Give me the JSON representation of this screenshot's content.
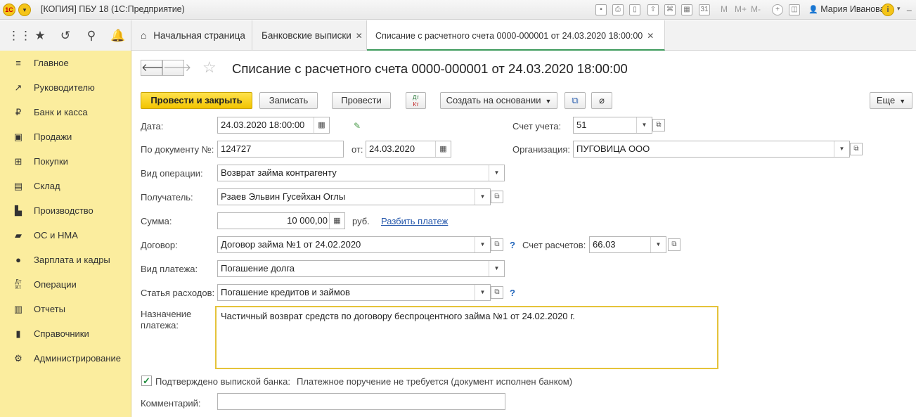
{
  "titlebar": {
    "logo": "1С",
    "title": "[КОПИЯ] ПБУ 18  (1С:Предприятие)",
    "user": "Мария Иванова",
    "zoom_labels": [
      "M",
      "M+",
      "M-"
    ],
    "calendar_day": "31"
  },
  "tabs": [
    {
      "label": "Начальная страница"
    },
    {
      "label": "Банковские выписки"
    },
    {
      "label": "Списание с расчетного счета 0000-000001 от 24.03.2020 18:00:00"
    }
  ],
  "sidebar": {
    "items": [
      {
        "label": "Главное",
        "icon": "menu-icon"
      },
      {
        "label": "Руководителю",
        "icon": "trend-icon"
      },
      {
        "label": "Банк и касса",
        "icon": "ruble-icon"
      },
      {
        "label": "Продажи",
        "icon": "bag-icon"
      },
      {
        "label": "Покупки",
        "icon": "cart-icon"
      },
      {
        "label": "Склад",
        "icon": "warehouse-icon"
      },
      {
        "label": "Производство",
        "icon": "factory-icon"
      },
      {
        "label": "ОС и НМА",
        "icon": "truck-icon"
      },
      {
        "label": "Зарплата и кадры",
        "icon": "person-icon"
      },
      {
        "label": "Операции",
        "icon": "dt-kt-icon"
      },
      {
        "label": "Отчеты",
        "icon": "bar-chart-icon"
      },
      {
        "label": "Справочники",
        "icon": "book-icon"
      },
      {
        "label": "Администрирование",
        "icon": "gear-icon"
      }
    ]
  },
  "document": {
    "title": "Списание с расчетного счета 0000-000001 от 24.03.2020 18:00:00"
  },
  "toolbar": {
    "post_close": "Провести и закрыть",
    "save": "Записать",
    "post": "Провести",
    "dt_kt": "Дт Кт",
    "create_based": "Создать на основании",
    "more": "Еще"
  },
  "form": {
    "date_label": "Дата:",
    "date_value": "24.03.2020 18:00:00",
    "account_label": "Счет учета:",
    "account_value": "51",
    "doc_num_label": "По документу №:",
    "doc_num_value": "124727",
    "from_label": "от:",
    "from_value": "24.03.2020",
    "org_label": "Организация:",
    "org_value": "ПУГОВИЦА ООО",
    "op_label": "Вид операции:",
    "op_value": "Возврат займа контрагенту",
    "recipient_label": "Получатель:",
    "recipient_value": "Рзаев Эльвин Гусейхан Оглы",
    "sum_label": "Сумма:",
    "sum_value": "10 000,00",
    "currency": "руб.",
    "split_link": "Разбить платеж",
    "contract_label": "Договор:",
    "contract_value": "Договор займа №1 от 24.02.2020",
    "q_mark": "?",
    "settle_label": "Счет расчетов:",
    "settle_value": "66.03",
    "paytype_label": "Вид платежа:",
    "paytype_value": "Погашение долга",
    "expense_label": "Статья расходов:",
    "expense_value": "Погашение кредитов и займов",
    "purpose_label": "Назначение платежа:",
    "purpose_value": "Частичный возврат средств по договору беспроцентного займа №1 от 24.02.2020 г.",
    "confirmed_label": "Подтверждено выпиской банка:",
    "confirmed_note": "Платежное поручение не требуется (документ исполнен банком)",
    "comment_label": "Комментарий:",
    "comment_value": ""
  }
}
